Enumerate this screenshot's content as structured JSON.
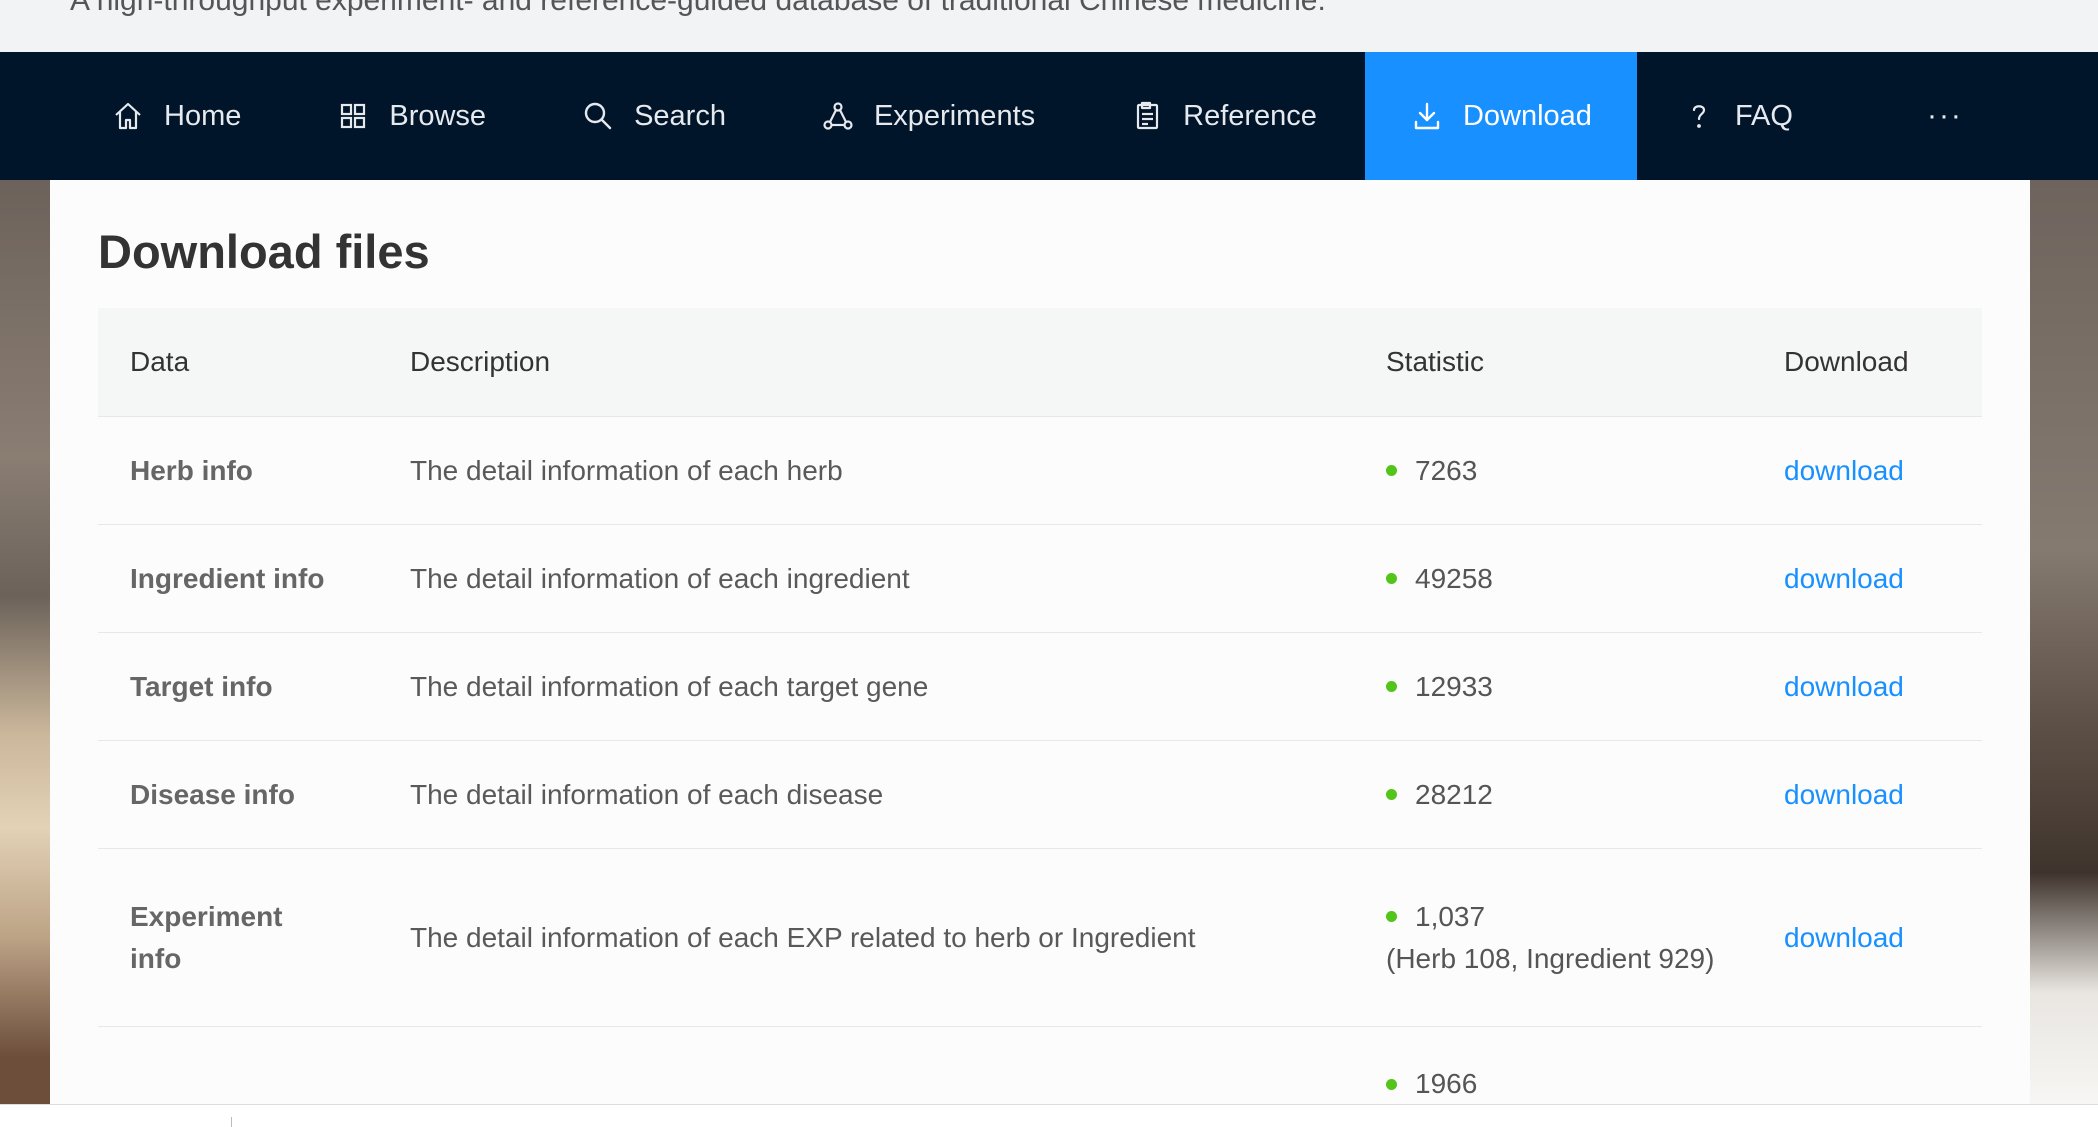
{
  "header": {
    "tagline": "A high-throughput experiment- and reference-guided database of traditional Chinese medicine."
  },
  "nav": {
    "items": [
      {
        "label": "Home",
        "icon": "home-icon"
      },
      {
        "label": "Browse",
        "icon": "grid-icon"
      },
      {
        "label": "Search",
        "icon": "search-icon"
      },
      {
        "label": "Experiments",
        "icon": "experiment-icon"
      },
      {
        "label": "Reference",
        "icon": "reference-icon"
      },
      {
        "label": "Download",
        "icon": "download-icon",
        "active": true
      },
      {
        "label": "FAQ",
        "icon": "question-icon"
      }
    ],
    "more": "···",
    "active_color": "#1890ff",
    "background_color": "#001529"
  },
  "main": {
    "title": "Download files",
    "table": {
      "headers": [
        "Data",
        "Description",
        "Statistic",
        "Download"
      ],
      "rows": [
        {
          "data": "Herb info",
          "description": "The detail information of each herb",
          "statistic": "7263",
          "statistic_detail": "",
          "link": "download"
        },
        {
          "data": "Ingredient info",
          "description": "The detail information of each ingredient",
          "statistic": "49258",
          "statistic_detail": "",
          "link": "download"
        },
        {
          "data": "Target info",
          "description": "The detail information of each target gene",
          "statistic": "12933",
          "statistic_detail": "",
          "link": "download"
        },
        {
          "data": "Disease info",
          "description": "The detail information of each disease",
          "statistic": "28212",
          "statistic_detail": "",
          "link": "download"
        },
        {
          "data": "Experiment info",
          "description": "The detail information of each EXP related to herb or Ingredient",
          "statistic": "1,037",
          "statistic_detail": "(Herb 108, Ingredient 929)",
          "link": "download"
        },
        {
          "data": "",
          "description": "",
          "statistic": "1966",
          "statistic_detail": "",
          "link": ""
        }
      ]
    },
    "status_dot_color": "#52c41a",
    "link_color": "#1890ff"
  }
}
